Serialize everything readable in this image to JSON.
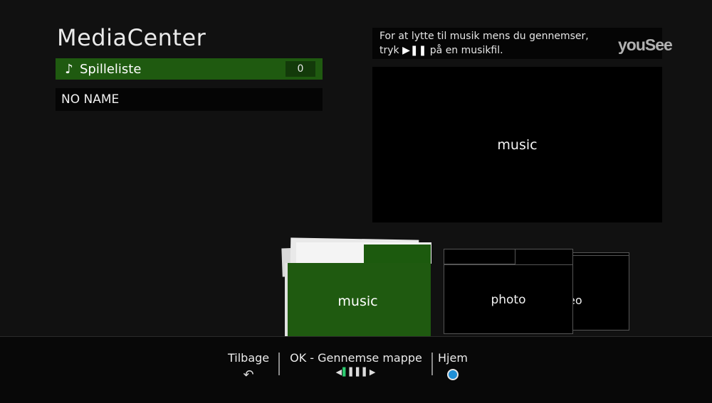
{
  "app": {
    "title": "MediaCenter",
    "brand": "youSee"
  },
  "sidebar": {
    "playlist": {
      "label": "Spilleliste",
      "count": "0",
      "icon": "music-note-icon"
    },
    "device": {
      "label": "NO NAME"
    }
  },
  "hint": {
    "line1": "For at lytte til musik mens du gennemser,",
    "line2_prefix": "tryk",
    "line2_icon": "▶❚❚",
    "line2_suffix": "på en musikfil."
  },
  "preview": {
    "label": "music"
  },
  "folders": [
    {
      "label": "music",
      "selected": true
    },
    {
      "label": "photo",
      "selected": false
    },
    {
      "label": "video",
      "visible_fragment": "eo",
      "selected": false
    }
  ],
  "footer": {
    "back_label": "Tilbage",
    "back_icon": "back-arrow-icon",
    "ok_label": "OK - Gennemse mappe",
    "ok_icon": "navigation-arrows-icon",
    "home_label": "Hjem",
    "home_icon": "blue-dot-icon"
  },
  "colors": {
    "accent_green": "#1f5a10",
    "background": "#111111",
    "home_blue": "#1f8fd6"
  }
}
